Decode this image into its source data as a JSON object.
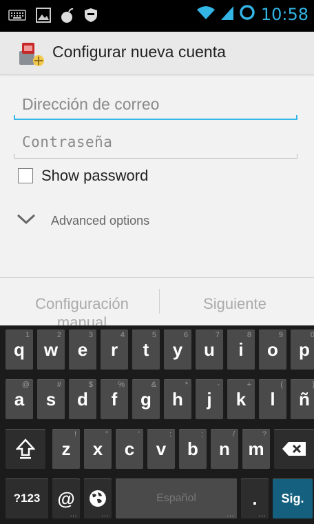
{
  "status_bar": {
    "time": "10:58"
  },
  "action_bar": {
    "title": "Configurar nueva cuenta"
  },
  "form": {
    "email_placeholder": "Dirección de correo",
    "password_placeholder": "Contraseña",
    "show_password_label": "Show password",
    "advanced_options_label": "Advanced options"
  },
  "buttons": {
    "manual_setup": "Configuración manual",
    "next": "Siguiente"
  },
  "keyboard": {
    "row1": [
      {
        "label": "q",
        "hint": "1"
      },
      {
        "label": "w",
        "hint": "2"
      },
      {
        "label": "e",
        "hint": "3"
      },
      {
        "label": "r",
        "hint": "4"
      },
      {
        "label": "t",
        "hint": "5"
      },
      {
        "label": "y",
        "hint": "6"
      },
      {
        "label": "u",
        "hint": "7"
      },
      {
        "label": "i",
        "hint": "8"
      },
      {
        "label": "o",
        "hint": "9"
      },
      {
        "label": "p",
        "hint": "0"
      }
    ],
    "row2": [
      {
        "label": "a",
        "hint": "@"
      },
      {
        "label": "s",
        "hint": "#"
      },
      {
        "label": "d",
        "hint": "$"
      },
      {
        "label": "f",
        "hint": "%"
      },
      {
        "label": "g",
        "hint": "&"
      },
      {
        "label": "h",
        "hint": "*"
      },
      {
        "label": "j",
        "hint": "-"
      },
      {
        "label": "k",
        "hint": "+"
      },
      {
        "label": "l",
        "hint": "("
      },
      {
        "label": "ñ",
        "hint": ")"
      }
    ],
    "row3": [
      {
        "label": "z",
        "hint": "!"
      },
      {
        "label": "x",
        "hint": "\""
      },
      {
        "label": "c",
        "hint": "'"
      },
      {
        "label": "v",
        "hint": ":"
      },
      {
        "label": "b",
        "hint": ";"
      },
      {
        "label": "n",
        "hint": "/"
      },
      {
        "label": "m",
        "hint": "?"
      }
    ],
    "symbols_key": "?123",
    "at_key": "@",
    "space_key": "Español",
    "period_key": ".",
    "action_key": "Sig."
  }
}
